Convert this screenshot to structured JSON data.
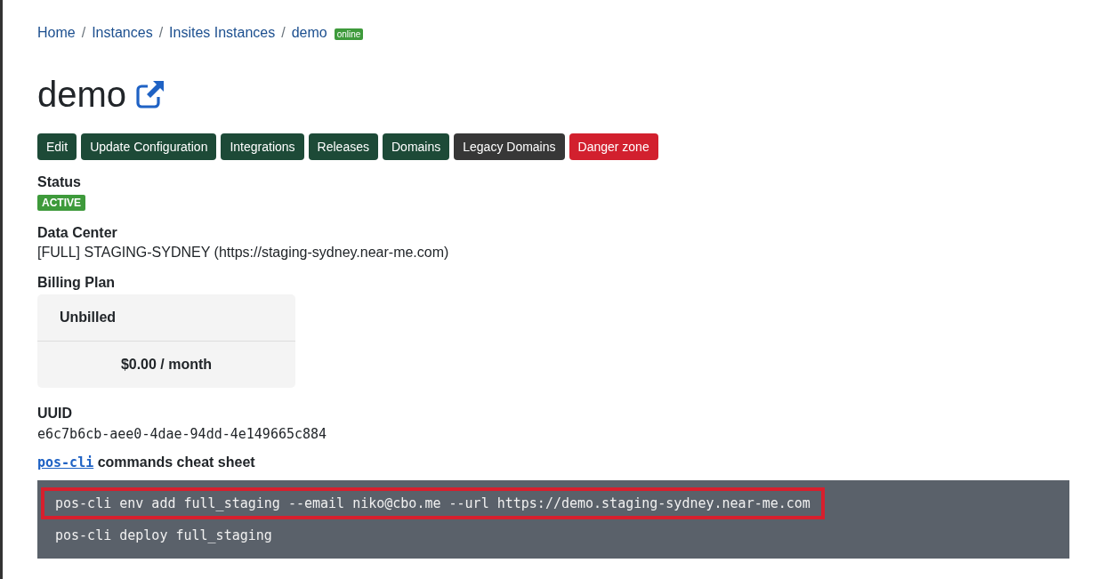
{
  "breadcrumbs": [
    "Home",
    "Instances",
    "Insites Instances",
    "demo"
  ],
  "breadcrumb_separator": "/",
  "breadcrumb_badge": "online",
  "title": "demo",
  "actions": [
    {
      "label": "Edit",
      "kind": "primary"
    },
    {
      "label": "Update Configuration",
      "kind": "primary"
    },
    {
      "label": "Integrations",
      "kind": "primary"
    },
    {
      "label": "Releases",
      "kind": "primary"
    },
    {
      "label": "Domains",
      "kind": "primary"
    },
    {
      "label": "Legacy Domains",
      "kind": "dark"
    },
    {
      "label": "Danger zone",
      "kind": "danger"
    }
  ],
  "status": {
    "label": "Status",
    "badge": "ACTIVE"
  },
  "data_center": {
    "label": "Data Center",
    "value": "[FULL] STAGING-SYDNEY (https://staging-sydney.near-me.com)"
  },
  "billing_plan": {
    "label": "Billing Plan",
    "name": "Unbilled",
    "price": "$0.00 / month"
  },
  "uuid": {
    "label": "UUID",
    "value": "e6c7b6cb-aee0-4dae-94dd-4e149665c884"
  },
  "cheat_sheet": {
    "link": "pos-cli",
    "title": "commands cheat sheet"
  },
  "commands": [
    {
      "text": "pos-cli env add full_staging --email niko@cbo.me --url https://demo.staging-sydney.near-me.com",
      "highlighted": true
    },
    {
      "text": "pos-cli deploy full_staging",
      "highlighted": false
    }
  ]
}
